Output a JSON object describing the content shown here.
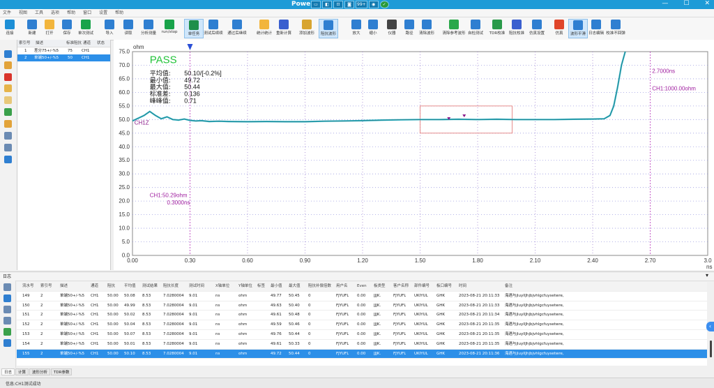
{
  "window": {
    "title": "Power",
    "minimize": "—",
    "maximize": "☐",
    "close": "✕",
    "tray": [
      "▭",
      "◧",
      "⊡",
      "◙",
      "99+",
      "◉",
      "✓"
    ]
  },
  "menu": [
    "文件",
    "视图",
    "工具",
    "选项",
    "帮助",
    "窗口",
    "设置",
    "帮助"
  ],
  "toolbar": [
    {
      "label": "连接",
      "color": "#1d8fd6"
    },
    {
      "label": "新建",
      "color": "#2f7fd1"
    },
    {
      "label": "打开",
      "color": "#f2b53c"
    },
    {
      "label": "保存",
      "color": "#2f7fd1"
    },
    {
      "label": "单次测试",
      "color": "#19a34a"
    },
    {
      "label": "导入",
      "color": "#2f7fd1"
    },
    {
      "label": "读取",
      "color": "#2f7fd1"
    },
    {
      "label": "分析测量",
      "color": "#2f7fd1"
    },
    {
      "label": "run/stop",
      "color": "#19a34a"
    },
    {
      "label": "单任务",
      "color": "#1d8f4a"
    },
    {
      "label": "测试后续续",
      "color": "#2f7fd1"
    },
    {
      "label": "通过后继续",
      "color": "#2f7fd1"
    },
    {
      "label": "统计统计",
      "color": "#f2b53c"
    },
    {
      "label": "重新计算",
      "color": "#3a5fcf"
    },
    {
      "label": "添加波形",
      "color": "#d8a530"
    },
    {
      "label": "阻抗波形",
      "color": "#2f7fd1"
    },
    {
      "label": "放大",
      "color": "#2f7fd1"
    },
    {
      "label": "缩小",
      "color": "#2f7fd1"
    },
    {
      "label": "仪器",
      "color": "#444444"
    },
    {
      "label": "路径",
      "color": "#2f7fd1"
    },
    {
      "label": "清除波形",
      "color": "#2f7fd1"
    },
    {
      "label": "清除参考波形",
      "color": "#2aa84a"
    },
    {
      "label": "自检测试",
      "color": "#2f7fd1"
    },
    {
      "label": "TDR校准",
      "color": "#2a9a4a"
    },
    {
      "label": "阻抗校准",
      "color": "#3a5fcf"
    },
    {
      "label": "仿真设置",
      "color": "#2f7fd1"
    },
    {
      "label": "仿真",
      "color": "#e0452a"
    },
    {
      "label": "波形平滑",
      "color": "#2f7fd1"
    },
    {
      "label": "日志编辑",
      "color": "#2f7fd1"
    },
    {
      "label": "校准不回弹",
      "color": "#2f7fd1"
    }
  ],
  "testlist": {
    "headers": [
      "索引号",
      "描述",
      "标准阻抗",
      "通道",
      "状态"
    ],
    "rows": [
      {
        "idx": "1",
        "desc": "差分75+/-%5",
        "imp": "75",
        "ch": "CH1",
        "state": ""
      },
      {
        "idx": "2",
        "desc": "单端50+/-%5",
        "imp": "50",
        "ch": "CH1",
        "state": ""
      }
    ]
  },
  "chart_data": {
    "type": "line",
    "title": "",
    "ylabel": "ohm",
    "xlabel": "ns",
    "xlim": [
      0,
      3.0
    ],
    "ylim": [
      0,
      75
    ],
    "xticks": [
      "0.00",
      "0.30",
      "0.60",
      "0.90",
      "1.20",
      "1.50",
      "1.80",
      "2.10",
      "2.40",
      "2.70",
      "3.0"
    ],
    "yticks": [
      "0.0",
      "5.0",
      "10.0",
      "15.0",
      "20.0",
      "25.0",
      "30.0",
      "35.0",
      "40.0",
      "45.0",
      "50.0",
      "55.0",
      "60.0",
      "65.0",
      "70.0",
      "75.0"
    ],
    "status": "PASS",
    "stats": [
      {
        "k": "平均值:",
        "v": "50.10/[-0.2%]"
      },
      {
        "k": "最小值:",
        "v": "49.72"
      },
      {
        "k": "最大值:",
        "v": "50.44"
      },
      {
        "k": "标准差:",
        "v": "0.136"
      },
      {
        "k": "峰峰值:",
        "v": "0.71"
      }
    ],
    "cursor1": {
      "x": 0.3,
      "label_val": "CH1:50.29ohm",
      "label_t": "0.3000ns"
    },
    "cursor2": {
      "x": 2.7,
      "label_val": "CH1:1000.00ohm",
      "label_t": "2.7000ns"
    },
    "marker_label": "CH1Z",
    "window": {
      "x0": 1.5,
      "x1": 1.98,
      "y0": 45,
      "y1": 55
    },
    "series": [
      {
        "color": "#31b3c4",
        "x": [
          0.0,
          0.03,
          0.06,
          0.09,
          0.12,
          0.15,
          0.18,
          0.21,
          0.24,
          0.27,
          0.3,
          0.33,
          0.36,
          0.4,
          0.45,
          0.5,
          0.6,
          0.7,
          0.8,
          0.9,
          1.0,
          1.1,
          1.2,
          1.3,
          1.4,
          1.5,
          1.6,
          1.7,
          1.8,
          1.9,
          2.0,
          2.1,
          2.2,
          2.3,
          2.4,
          2.46,
          2.49,
          2.51,
          2.53,
          2.55,
          2.57
        ],
        "y": [
          49.5,
          50.5,
          51.5,
          53.0,
          51.5,
          50.3,
          51.0,
          50.0,
          49.8,
          50.2,
          49.7,
          49.5,
          49.6,
          49.3,
          49.4,
          49.3,
          49.2,
          49.3,
          49.2,
          49.2,
          49.4,
          49.5,
          49.6,
          49.8,
          49.9,
          50.0,
          50.0,
          50.1,
          50.0,
          50.1,
          50.0,
          50.0,
          50.0,
          50.1,
          50.2,
          50.3,
          51.5,
          55.0,
          62.0,
          70.0,
          76.0
        ]
      }
    ]
  },
  "log": {
    "title": "日志",
    "headers": [
      "流水号",
      "索引号",
      "描述",
      "通道",
      "阻抗",
      "平均值",
      "测试结果",
      "阻抗长度",
      "测试时间",
      "X轴单位",
      "Y轴单位",
      "标签",
      "最小值",
      "最大值",
      "阻抗补偿倍数",
      "用户名",
      "Even",
      "板类型",
      "客户名称",
      "部件编号",
      "板口编号",
      "时间",
      "备注"
    ],
    "rows": [
      [
        "149",
        "2",
        "单端50+/-%5",
        "CH1",
        "50.00",
        "50.08",
        "8.53",
        "7.0280004",
        "9.01",
        "ns",
        "ohm",
        "",
        "49.77",
        "50.45",
        "0",
        "FJYUFL",
        "0.00",
        "JJJK.",
        "FJYUFL",
        "UKIYUL",
        "GHK",
        "2023-08-21 20:11:33",
        "海遇与jluyllJhjbjvhlgcfuysetwre,"
      ],
      [
        "150",
        "2",
        "单端50+/-%5",
        "CH1",
        "50.00",
        "49.99",
        "8.53",
        "7.0280004",
        "9.01",
        "ns",
        "ohm",
        "",
        "49.63",
        "50.40",
        "0",
        "FJYUFL",
        "0.00",
        "JJJK.",
        "FJYUFL",
        "UKIYUL",
        "GHK",
        "2023-08-21 20:11:33",
        "海遇与jluyllJhjbjvhlgcfuysetwre,"
      ],
      [
        "151",
        "2",
        "单端50+/-%5",
        "CH1",
        "50.00",
        "50.02",
        "8.53",
        "7.0280004",
        "9.01",
        "ns",
        "ohm",
        "",
        "49.61",
        "50.48",
        "0",
        "FJYUFL",
        "0.00",
        "JJJK.",
        "FJYUFL",
        "UKIYUL",
        "GHK",
        "2023-08-21 20:11:34",
        "海遇与jluyllJhjbjvhlgcfuysetwre,"
      ],
      [
        "152",
        "2",
        "单端50+/-%5",
        "CH1",
        "50.00",
        "50.04",
        "8.53",
        "7.0280004",
        "9.01",
        "ns",
        "ohm",
        "",
        "49.59",
        "50.46",
        "0",
        "FJYUFL",
        "0.00",
        "JJJK.",
        "FJYUFL",
        "UKIYUL",
        "GHK",
        "2023-08-21 20:11:35",
        "海遇与jluyllJhjbjvhlgcfuysetwre,"
      ],
      [
        "153",
        "2",
        "单端50+/-%5",
        "CH1",
        "50.00",
        "50.07",
        "8.53",
        "7.0280004",
        "9.01",
        "ns",
        "ohm",
        "",
        "49.76",
        "50.44",
        "0",
        "FJYUFL",
        "0.00",
        "JJJK.",
        "FJYUFL",
        "UKIYUL",
        "GHK",
        "2023-08-21 20:11:35",
        "海遇与jluyllJhjbjvhlgcfuysetwre,"
      ],
      [
        "154",
        "2",
        "单端50+/-%5",
        "CH1",
        "50.00",
        "50.01",
        "8.53",
        "7.0280004",
        "9.01",
        "ns",
        "ohm",
        "",
        "49.61",
        "50.33",
        "0",
        "FJYUFL",
        "0.00",
        "JJJK.",
        "FJYUFL",
        "UKIYUL",
        "GHK",
        "2023-08-21 20:11:35",
        "海遇与jluyllJhjbjvhlgcfuysetwre,"
      ],
      [
        "155",
        "2",
        "单端50+/-%5",
        "CH1",
        "50.00",
        "50.10",
        "8.53",
        "7.0280004",
        "9.01",
        "ns",
        "ohm",
        "",
        "49.72",
        "50.44",
        "0",
        "FJYUFL",
        "0.00",
        "JJJK.",
        "FJYUFL",
        "UKIYUL",
        "GHK",
        "2023-08-21 20:11:36",
        "海遇与jluyllJhjbjvhlgcfuysetwre,"
      ]
    ]
  },
  "bottom_tabs": [
    "日志",
    "计算",
    "波形分析",
    "TDR参数"
  ],
  "status": "信息:CH1测试成功"
}
